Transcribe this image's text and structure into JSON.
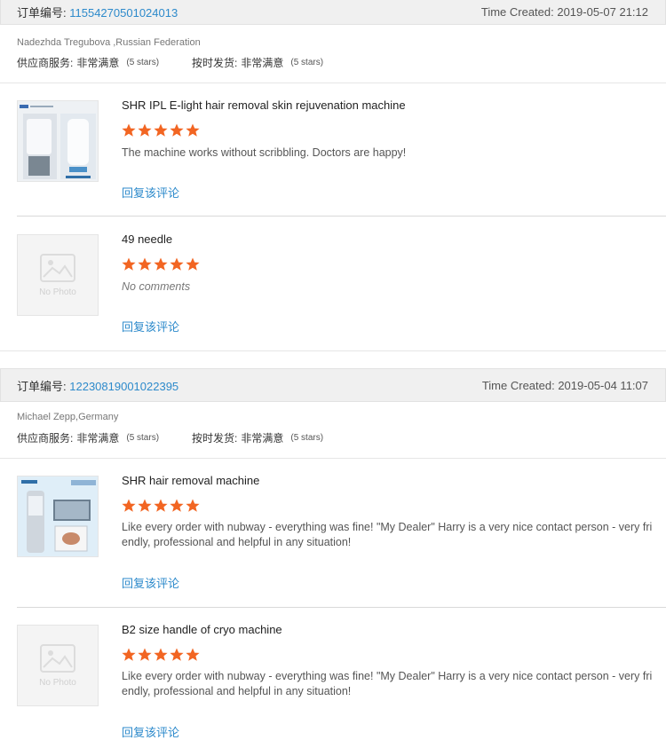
{
  "orders": [
    {
      "order_no_label": "订单编号:",
      "order_no": "11554270501024013",
      "time_created": "Time Created: 2019-05-07 21:12",
      "reviewer": "Nadezhda Tregubova ,Russian Federation",
      "supplier_service_label": "供应商服务:",
      "supplier_service_value": "非常满意",
      "supplier_service_stars": "(5 stars)",
      "on_time_label": "按时发货:",
      "on_time_value": "非常满意",
      "on_time_stars": "(5 stars)",
      "items": [
        {
          "title": "SHR IPL E-light hair removal skin rejuvenation machine",
          "rating": 5,
          "comment": "The machine works without scribbling. Doctors are happy!",
          "reply_label": "回复该评论",
          "thumb": "machine-photo"
        },
        {
          "title": "49 needle",
          "rating": 5,
          "comment": "No comments",
          "reply_label": "回复该评论",
          "thumb": "no-photo",
          "no_photo_text": "No Photo"
        }
      ]
    },
    {
      "order_no_label": "订单编号:",
      "order_no": "12230819001022395",
      "time_created": "Time Created: 2019-05-04 11:07",
      "reviewer": "Michael Zepp,Germany",
      "supplier_service_label": "供应商服务:",
      "supplier_service_value": "非常满意",
      "supplier_service_stars": "(5 stars)",
      "on_time_label": "按时发货:",
      "on_time_value": "非常满意",
      "on_time_stars": "(5 stars)",
      "items": [
        {
          "title": "SHR hair removal machine",
          "rating": 5,
          "comment": "Like every order with nubway - everything was fine! \"My Dealer\" Harry is a very nice contact person - very fri endly, professional and helpful in any situation!",
          "reply_label": "回复该评论",
          "thumb": "machine-photo-2"
        },
        {
          "title": "B2 size handle of cryo machine",
          "rating": 5,
          "comment": "Like every order with nubway - everything was fine! \"My Dealer\" Harry is a very nice contact person - very fri endly, professional and helpful in any situation!",
          "reply_label": "回复该评论",
          "thumb": "no-photo",
          "no_photo_text": "No Photo"
        }
      ]
    }
  ],
  "colors": {
    "star": "#f26522",
    "link": "#2d8acb",
    "header_bg": "#f0f0f0"
  }
}
